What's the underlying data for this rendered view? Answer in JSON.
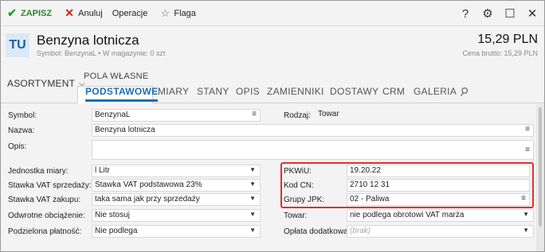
{
  "toolbar": {
    "save_label": "ZAPISZ",
    "cancel_label": "Anuluj",
    "operations_label": "Operacje",
    "flag_label": "Flaga",
    "save_icon": "check-icon",
    "cancel_icon": "close-icon",
    "flag_icon": "star-icon",
    "help_glyph": "?",
    "settings_glyph": "⚙",
    "maximize_glyph": "☐",
    "close_glyph": "✕"
  },
  "header": {
    "avatar_text": "TU",
    "title": "Benzyna lotnicza",
    "subtitle": "Symbol: BenzynaL  •  W magazynie: 0 szt",
    "price": "15,29 PLN",
    "price_sub": "Cena brutto: 15,29 PLN"
  },
  "tabs": {
    "assortment_label": "ASORTYMENT",
    "group_label": "POLA WŁASNE",
    "items": [
      {
        "label": "PODSTAWOWE",
        "active": true
      },
      {
        "label": "MIARY",
        "active": false
      },
      {
        "label": "STANY",
        "active": false
      },
      {
        "label": "OPIS",
        "active": false
      },
      {
        "label": "ZAMIENNIKI",
        "active": false
      },
      {
        "label": "DOSTAWY",
        "active": false
      },
      {
        "label": "CRM",
        "active": false
      },
      {
        "label": "GALERIA",
        "active": false
      }
    ],
    "attachment_icon": "paperclip-icon"
  },
  "form": {
    "symbol_label": "Symbol:",
    "symbol_value": "BenzynaL",
    "rodzaj_label": "Rodzaj:",
    "rodzaj_value": "Towar",
    "nazwa_label": "Nazwa:",
    "nazwa_value": "Benzyna lotnicza",
    "opis_label": "Opis:",
    "opis_value": "",
    "jm_label": "Jednostka miary:",
    "jm_value": "l  Litr",
    "vat_sprz_label": "Stawka VAT sprzedaży:",
    "vat_sprz_value": "Stawka VAT podstawowa 23%",
    "vat_zak_label": "Stawka VAT zakupu:",
    "vat_zak_value": "taka sama jak przy sprzedaży",
    "odwr_label": "Odwrotne obciążenie:",
    "odwr_value": "Nie stosuj",
    "podz_label": "Podzielona płatność:",
    "podz_value": "Nie podlega",
    "pkwiu_label": "PKWiU:",
    "pkwiu_value": "19.20.22",
    "kodcn_label": "Kod CN:",
    "kodcn_value": "2710 12 31",
    "jpk_label": "Grupy JPK:",
    "jpk_value": "02 - Paliwa",
    "towar_label": "Towar:",
    "towar_value": "nie podlega obrotowi VAT marża",
    "oplata_label": "Opłata dodatkowa:",
    "oplata_value": "(brak)",
    "menu_glyph": "≡",
    "dropdown_glyph": "⌄"
  },
  "colors": {
    "accent": "#1a6fb5",
    "save_green": "#2a9d2a",
    "cancel_red": "#d32020",
    "highlight_red": "#e03030"
  }
}
